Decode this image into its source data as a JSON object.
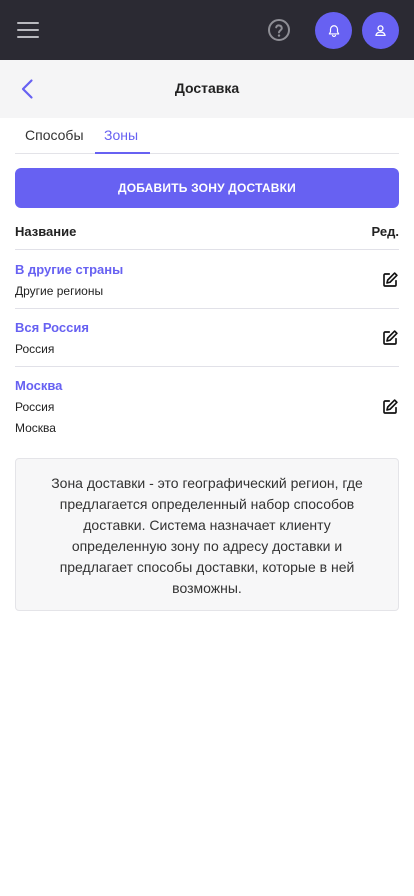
{
  "header": {
    "icons": [
      "menu-icon",
      "help-icon",
      "bell-icon",
      "user-icon"
    ],
    "accent_color": "#6761f2",
    "background_color": "#2b2a33"
  },
  "page": {
    "title": "Доставка"
  },
  "tabs": [
    {
      "label": "Способы",
      "active": false
    },
    {
      "label": "Зоны",
      "active": true
    }
  ],
  "actions": {
    "add_zone_label": "ДОБАВИТЬ ЗОНУ ДОСТАВКИ"
  },
  "table": {
    "col_name": "Название",
    "col_edit": "Ред.",
    "rows": [
      {
        "name": "В другие страны",
        "details": [
          "Другие регионы"
        ]
      },
      {
        "name": "Вся Россия",
        "details": [
          "Россия"
        ]
      },
      {
        "name": "Москва",
        "details": [
          "Россия",
          "Москва"
        ]
      }
    ]
  },
  "info": {
    "text": "Зона доставки - это географический регион, где предлагается определенный набор способов доставки. Система назначает клиенту определенную зону по адресу доставки и предлагает способы доставки, которые в ней возможны."
  }
}
